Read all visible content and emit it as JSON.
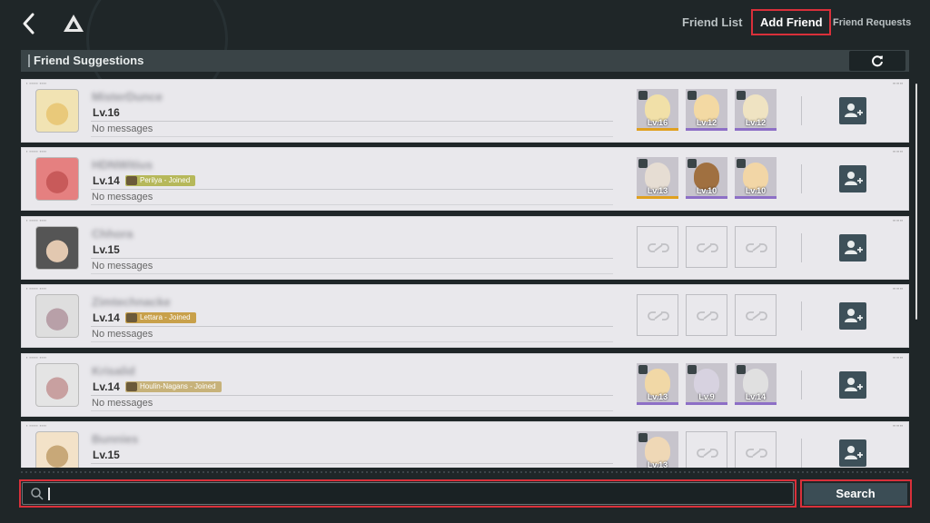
{
  "tabs": {
    "friend_list": "Friend List",
    "add_friend": "Add Friend",
    "friend_requests": "Friend Requests"
  },
  "section_title": "Friend Suggestions",
  "rows": [
    {
      "name": "MisterDunce",
      "level": "Lv.16",
      "message": "No messages",
      "avatar_colors": [
        "#f1e3b3",
        "#e9c97a"
      ],
      "badge": null,
      "slots": [
        {
          "level": "Lv.16",
          "color": "#f1e0a8",
          "frame": "#e0a020"
        },
        {
          "level": "Lv.12",
          "color": "#f3d9a3",
          "frame": "#8d6fc6"
        },
        {
          "level": "Lv.12",
          "color": "#efe3c2",
          "frame": "#8d6fc6"
        }
      ]
    },
    {
      "name": "HDNWitius",
      "level": "Lv.14",
      "message": "No messages",
      "avatar_colors": [
        "#e58080",
        "#c85a5a"
      ],
      "badge": {
        "text": "Perilya - Joined",
        "color": "#b6b85a"
      },
      "slots": [
        {
          "level": "Lv.13",
          "color": "#e6ddd3",
          "frame": "#e0a020"
        },
        {
          "level": "Lv.10",
          "color": "#a07040",
          "frame": "#8d6fc6"
        },
        {
          "level": "Lv.10",
          "color": "#f2d6a6",
          "frame": "#8d6fc6"
        }
      ]
    },
    {
      "name": "Chhora",
      "level": "Lv.15",
      "message": "No messages",
      "avatar_colors": [
        "#555555",
        "#e2c8b0"
      ],
      "badge": null,
      "slots": []
    },
    {
      "name": "Zimtechnacke",
      "level": "Lv.14",
      "message": "No messages",
      "avatar_colors": [
        "#dedede",
        "#b8a0a8"
      ],
      "badge": {
        "text": "Lettara - Joined",
        "color": "#c8a04a"
      },
      "slots": []
    },
    {
      "name": "Krisalid",
      "level": "Lv.14",
      "message": "No messages",
      "avatar_colors": [
        "#e4e4e4",
        "#c8a0a0"
      ],
      "badge": {
        "text": "Houlin-Nagans - Joined",
        "color": "#c7b27a"
      },
      "slots": [
        {
          "level": "Lv.13",
          "color": "#f1d8a6",
          "frame": "#8d6fc6"
        },
        {
          "level": "Lv.9",
          "color": "#d7d2e0",
          "frame": "#8d6fc6"
        },
        {
          "level": "Lv.14",
          "color": "#e0e0e0",
          "frame": "#8d6fc6"
        }
      ]
    },
    {
      "name": "Bunnies",
      "level": "Lv.15",
      "message": "",
      "avatar_colors": [
        "#f3e2c8",
        "#c8a878"
      ],
      "badge": null,
      "slots": [
        {
          "level": "Lv.13",
          "color": "#efd8b6",
          "frame": "#8d6fc6"
        }
      ]
    }
  ],
  "colors": {
    "background": "#1f2628",
    "highlight": "#d9303a",
    "button": "#3d5059"
  },
  "icons": {
    "back": "back-arrow-icon",
    "logo": "triangle-logo-icon",
    "refresh": "refresh-icon",
    "add_friend": "add-friend-icon",
    "empty_slot": "link-icon",
    "search": "search-icon"
  },
  "search": {
    "value": "",
    "button_label": "Search"
  }
}
